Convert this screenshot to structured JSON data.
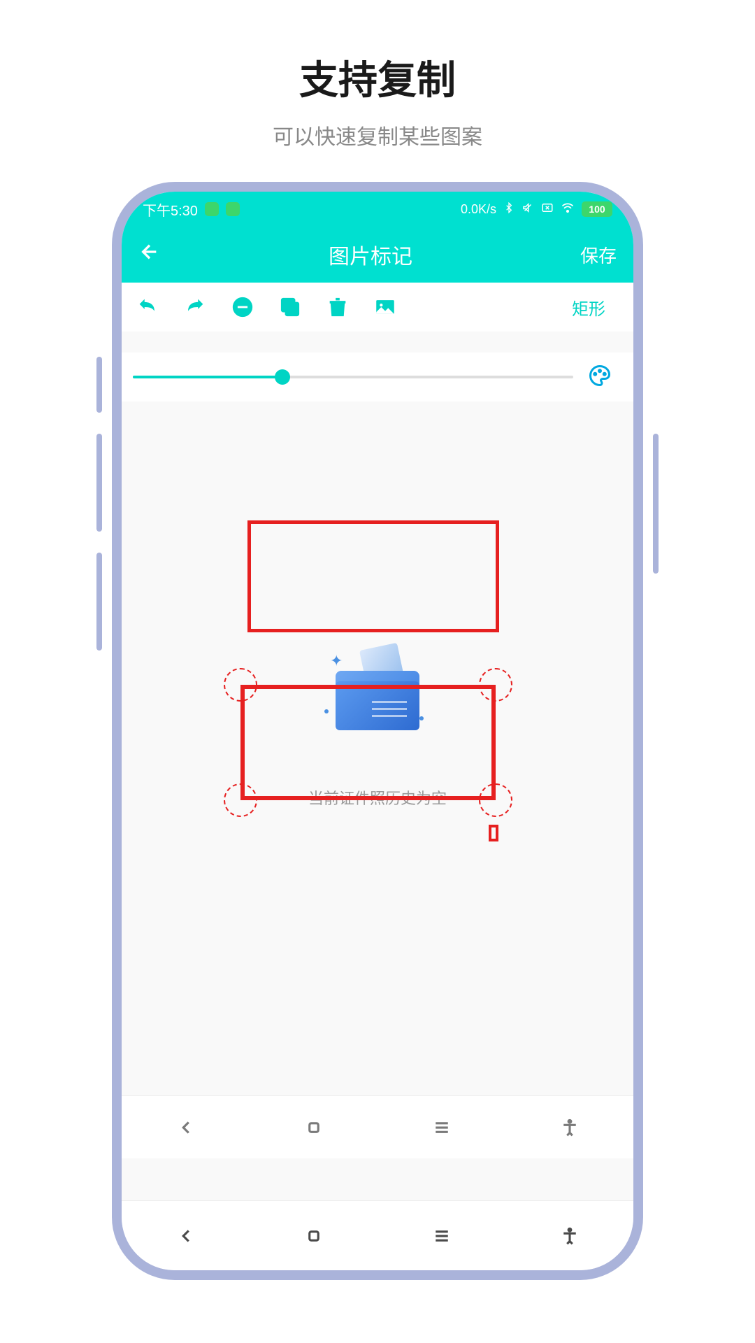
{
  "promo": {
    "title": "支持复制",
    "subtitle": "可以快速复制某些图案"
  },
  "status_bar": {
    "time": "下午5:30",
    "net_speed": "0.0K/s",
    "battery_percent": "100"
  },
  "header": {
    "title": "图片标记",
    "save_label": "保存"
  },
  "toolbar": {
    "shape_label": "矩形"
  },
  "canvas": {
    "empty_text": "当前证件照历史为空"
  },
  "slider": {
    "value_percent": 34
  },
  "colors": {
    "accent": "#00e0d0",
    "accent2": "#00d4c4",
    "annotation_red": "#e62020",
    "phone_frame": "#aab3da"
  }
}
